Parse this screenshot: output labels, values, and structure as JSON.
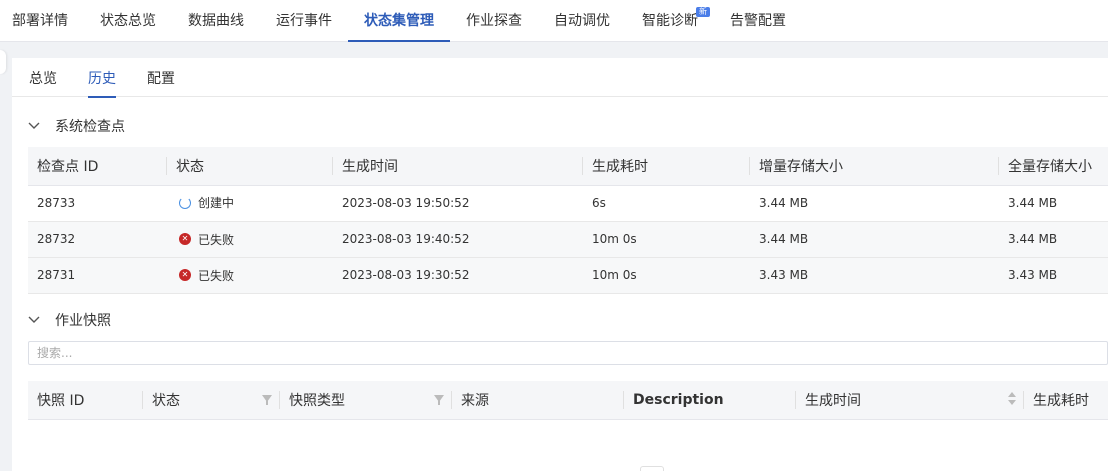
{
  "top_tabs": [
    {
      "label": "部署详情"
    },
    {
      "label": "状态总览"
    },
    {
      "label": "数据曲线"
    },
    {
      "label": "运行事件"
    },
    {
      "label": "状态集管理"
    },
    {
      "label": "作业探查"
    },
    {
      "label": "自动调优"
    },
    {
      "label": "智能诊断",
      "badge": "新"
    },
    {
      "label": "告警配置"
    }
  ],
  "sub_tabs": [
    {
      "label": "总览"
    },
    {
      "label": "历史"
    },
    {
      "label": "配置"
    }
  ],
  "checkpoints": {
    "title": "系统检查点",
    "columns": [
      "检查点 ID",
      "状态",
      "生成时间",
      "生成耗时",
      "增量存储大小",
      "全量存储大小"
    ],
    "rows": [
      {
        "id": "28733",
        "status_icon": "loading-icon",
        "status": "创建中",
        "time": "2023-08-03 19:50:52",
        "duration": "6s",
        "incremental": "3.44 MB",
        "full": "3.44 MB"
      },
      {
        "id": "28732",
        "status_icon": "error-icon",
        "status": "已失败",
        "time": "2023-08-03 19:40:52",
        "duration": "10m 0s",
        "incremental": "3.44 MB",
        "full": "3.44 MB"
      },
      {
        "id": "28731",
        "status_icon": "error-icon",
        "status": "已失败",
        "time": "2023-08-03 19:30:52",
        "duration": "10m 0s",
        "incremental": "3.43 MB",
        "full": "3.43 MB"
      }
    ]
  },
  "snapshots": {
    "title": "作业快照",
    "search_placeholder": "搜索...",
    "columns": [
      "快照 ID",
      "状态",
      "快照类型",
      "来源",
      "Description",
      "生成时间",
      "生成耗时"
    ]
  },
  "colors": {
    "accent": "#2e5cb8",
    "error": "#c62828",
    "loading": "#4a90e2",
    "badge": "#4a7de8"
  }
}
